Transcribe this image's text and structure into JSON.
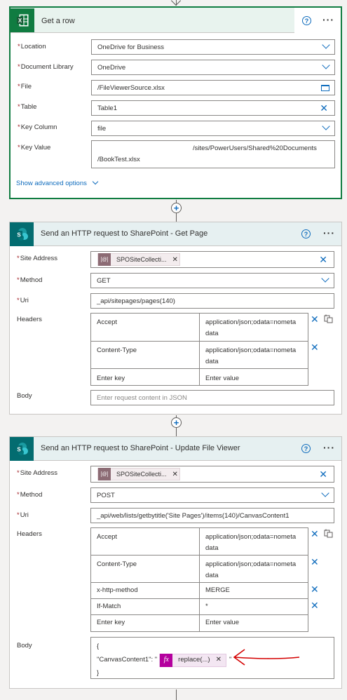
{
  "colors": {
    "accent": "#0f6cbd",
    "excel": "#107c41",
    "sharepoint": "#036c70",
    "required": "#a4262c",
    "arrow": "#d40000"
  },
  "get_row": {
    "title": "Get a row",
    "icon": "excel-icon",
    "fields": {
      "location": {
        "label": "Location",
        "value": "OneDrive for Business"
      },
      "library": {
        "label": "Document Library",
        "value": "OneDrive"
      },
      "file": {
        "label": "File",
        "value": "/FileViewerSource.xlsx"
      },
      "table": {
        "label": "Table",
        "value": "Table1"
      },
      "key_column": {
        "label": "Key Column",
        "value": "file"
      },
      "key_value": {
        "label": "Key Value",
        "line1": "/sites/PowerUsers/Shared%20Documents",
        "line2": "/BookTest.xlsx"
      }
    },
    "advanced": "Show advanced options"
  },
  "get_page": {
    "title": "Send an HTTP request to SharePoint - Get Page",
    "icon": "sharepoint-icon",
    "site_label": "Site Address",
    "site_token": "SPOSiteCollecti...",
    "method_label": "Method",
    "method": "GET",
    "uri_label": "Uri",
    "uri": "_api/sitepages/pages(140)",
    "headers_label": "Headers",
    "headers": [
      {
        "key": "Accept",
        "value": "application/json;odata=nometa",
        "value2": "data"
      },
      {
        "key": "Content-Type",
        "value": "application/json;odata=nometa",
        "value2": "data"
      }
    ],
    "key_placeholder": "Enter key",
    "value_placeholder": "Enter value",
    "body_label": "Body",
    "body_placeholder": "Enter request content in JSON"
  },
  "update": {
    "title": "Send an HTTP request to SharePoint - Update File Viewer",
    "icon": "sharepoint-icon",
    "site_label": "Site Address",
    "site_token": "SPOSiteCollecti...",
    "method_label": "Method",
    "method": "POST",
    "uri_label": "Uri",
    "uri": "_api/web/lists/getbytitle('Site Pages')/items(140)/CanvasContent1",
    "headers_label": "Headers",
    "headers": [
      {
        "key": "Accept",
        "value": "application/json;odata=nometa",
        "value2": "data"
      },
      {
        "key": "Content-Type",
        "value": "application/json;odata=nometa",
        "value2": "data"
      },
      {
        "key": "x-http-method",
        "value": "MERGE",
        "value2": ""
      },
      {
        "key": "If-Match",
        "value": "*",
        "value2": ""
      }
    ],
    "key_placeholder": "Enter key",
    "value_placeholder": "Enter value",
    "body_label": "Body",
    "body_open": "{",
    "body_key": "\"CanvasContent1\": \"",
    "body_fx": "fx",
    "body_token": "replace(...)",
    "body_close_quote": "\"",
    "body_close": "}"
  }
}
